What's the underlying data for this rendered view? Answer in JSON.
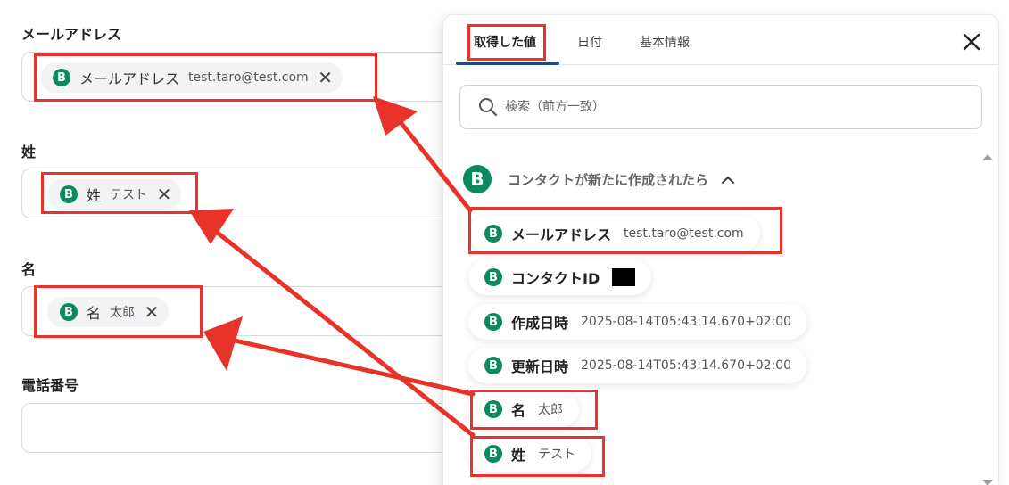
{
  "form": {
    "fields": [
      {
        "label": "メールアドレス",
        "chip_name": "メールアドレス",
        "chip_value": "test.taro@test.com"
      },
      {
        "label": "姓",
        "chip_name": "姓",
        "chip_value": "テスト"
      },
      {
        "label": "名",
        "chip_name": "名",
        "chip_value": "太郎"
      },
      {
        "label": "電話番号"
      }
    ],
    "remove_symbol": "✕",
    "badge_letter": "B"
  },
  "panel": {
    "tabs": [
      {
        "label": "取得した値",
        "active": true
      },
      {
        "label": "日付",
        "active": false
      },
      {
        "label": "基本情報",
        "active": false
      }
    ],
    "search_placeholder": "検索（前方一致）",
    "group_title": "コンタクトが新たに作成されたら",
    "items": [
      {
        "name": "メールアドレス",
        "value": "test.taro@test.com"
      },
      {
        "name": "コンタクトID",
        "value": "",
        "masked": true
      },
      {
        "name": "作成日時",
        "value": "2025-08-14T05:43:14.670+02:00"
      },
      {
        "name": "更新日時",
        "value": "2025-08-14T05:43:14.670+02:00"
      },
      {
        "name": "名",
        "value": "太郎"
      },
      {
        "name": "姓",
        "value": "テスト"
      }
    ]
  },
  "colors": {
    "badge": "#0b8a5f",
    "highlight": "#e8332a",
    "tab_underline": "#1f4b73"
  },
  "icons": {
    "badge": "b-badge-icon",
    "remove": "close-icon",
    "search": "search-icon",
    "chevron": "chevron-up-icon",
    "close_panel": "close-icon"
  }
}
